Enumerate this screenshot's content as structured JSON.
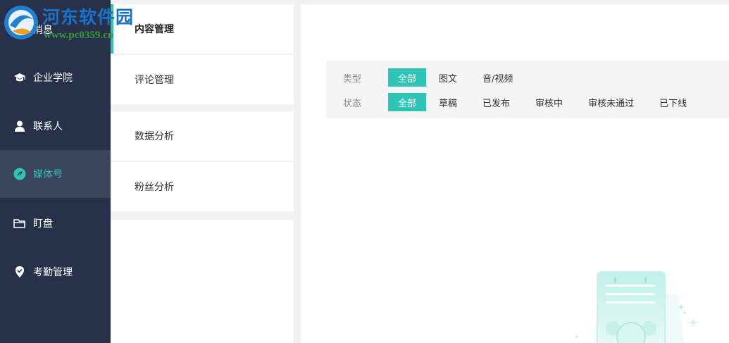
{
  "watermark": {
    "title": "河东软件园",
    "url": "www.pc0359.cn"
  },
  "sidebar": {
    "items": [
      {
        "label": "消息",
        "icon": "message-icon",
        "active": false
      },
      {
        "label": "企业学院",
        "icon": "graduation-cap-icon",
        "active": false
      },
      {
        "label": "联系人",
        "icon": "person-icon",
        "active": false
      },
      {
        "label": "媒体号",
        "icon": "leaf-icon",
        "active": true
      },
      {
        "label": "盯盘",
        "icon": "folder-icon",
        "active": false
      },
      {
        "label": "考勤管理",
        "icon": "location-check-icon",
        "active": false
      }
    ]
  },
  "submenu": {
    "items": [
      {
        "label": "内容管理",
        "active": true
      },
      {
        "label": "评论管理",
        "active": false
      },
      {
        "label": "数据分析",
        "active": false
      },
      {
        "label": "粉丝分析",
        "active": false
      }
    ]
  },
  "filters": {
    "type": {
      "label": "类型",
      "options": [
        "全部",
        "图文",
        "音/视频"
      ],
      "selected": "全部"
    },
    "status": {
      "label": "状态",
      "options": [
        "全部",
        "草稿",
        "已发布",
        "审核中",
        "审核未通过",
        "已下线"
      ],
      "selected": "全部"
    }
  },
  "colors": {
    "sidebar_bg": "#27314a",
    "sidebar_active_bg": "#3a445c",
    "accent": "#2ec5b6",
    "page_bg": "#f0f1f3"
  },
  "illustration": {
    "icon": "empty-clipboard-clock-illustration"
  }
}
